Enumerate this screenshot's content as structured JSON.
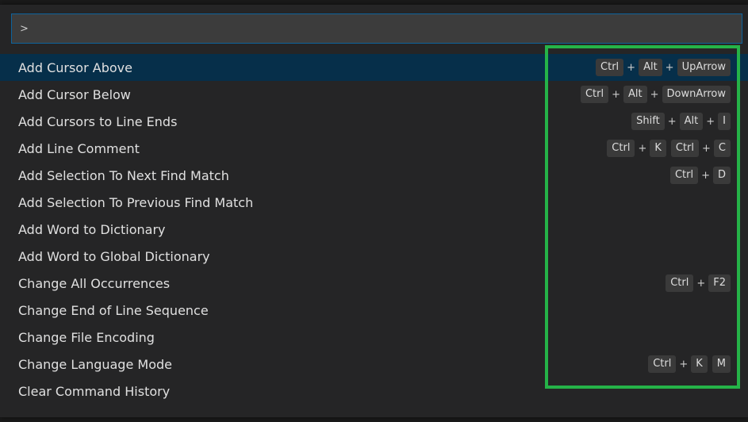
{
  "search": {
    "value": ">"
  },
  "commands": [
    {
      "label": "Add Cursor Above",
      "selected": true,
      "chords": [
        [
          "Ctrl",
          "Alt",
          "UpArrow"
        ]
      ]
    },
    {
      "label": "Add Cursor Below",
      "selected": false,
      "chords": [
        [
          "Ctrl",
          "Alt",
          "DownArrow"
        ]
      ]
    },
    {
      "label": "Add Cursors to Line Ends",
      "selected": false,
      "chords": [
        [
          "Shift",
          "Alt",
          "I"
        ]
      ]
    },
    {
      "label": "Add Line Comment",
      "selected": false,
      "chords": [
        [
          "Ctrl",
          "K"
        ],
        [
          "Ctrl",
          "C"
        ]
      ]
    },
    {
      "label": "Add Selection To Next Find Match",
      "selected": false,
      "chords": [
        [
          "Ctrl",
          "D"
        ]
      ]
    },
    {
      "label": "Add Selection To Previous Find Match",
      "selected": false,
      "chords": []
    },
    {
      "label": "Add Word to Dictionary",
      "selected": false,
      "chords": []
    },
    {
      "label": "Add Word to Global Dictionary",
      "selected": false,
      "chords": []
    },
    {
      "label": "Change All Occurrences",
      "selected": false,
      "chords": [
        [
          "Ctrl",
          "F2"
        ]
      ]
    },
    {
      "label": "Change End of Line Sequence",
      "selected": false,
      "chords": []
    },
    {
      "label": "Change File Encoding",
      "selected": false,
      "chords": []
    },
    {
      "label": "Change Language Mode",
      "selected": false,
      "chords": [
        [
          "Ctrl",
          "K"
        ],
        [
          "M"
        ]
      ]
    },
    {
      "label": "Clear Command History",
      "selected": false,
      "chords": []
    }
  ],
  "colors": {
    "selection_background": "#062f4a",
    "highlight_border": "#25b348",
    "input_border": "#0e639c"
  }
}
